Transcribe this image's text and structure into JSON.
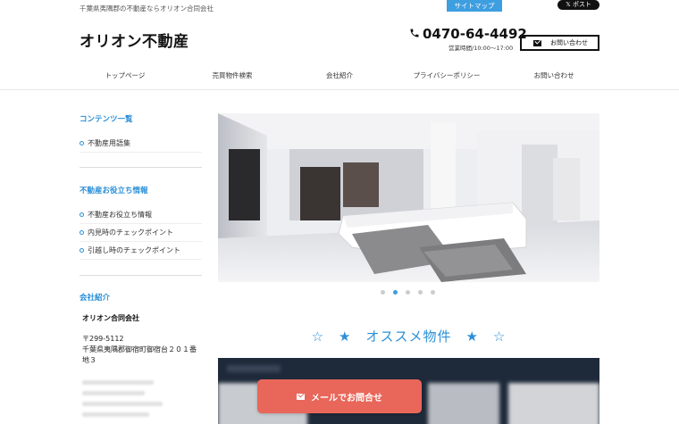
{
  "header": {
    "tagline": "千葉県夷隅郡の不動産ならオリオン合同会社",
    "sitemap_label": "サイトマップ",
    "x_post_label": "ポスト",
    "logo": "オリオン不動産",
    "phone": "0470-64-4492",
    "hours": "営業時間/10:00〜17:00",
    "contact_label": "お問い合わせ"
  },
  "nav": [
    "トップページ",
    "売買物件検索",
    "会社紹介",
    "プライバシーポリシー",
    "お問い合わせ"
  ],
  "sidebar": {
    "contents_heading": "コンテンツ一覧",
    "contents_items": [
      "不動産用語集"
    ],
    "useful_heading": "不動産お役立ち情報",
    "useful_items": [
      "不動産お役立ち情報",
      "内見時のチェックポイント",
      "引越し時のチェックポイント"
    ],
    "company_heading": "会社紹介",
    "company_name": "オリオン合同会社",
    "postal": "〒299-5112",
    "address": "千葉県夷隅郡御宿町御宿台２０１番地３"
  },
  "slider": {
    "dot_count": 5,
    "active_index": 1
  },
  "featured": {
    "title": "☆　★　オススメ物件　★　☆"
  },
  "cta": {
    "mail_label": "メールでお問合せ"
  },
  "colors": {
    "accent": "#2b8fd7",
    "cta": "#e8675a",
    "sitemap": "#3d9ee0"
  }
}
